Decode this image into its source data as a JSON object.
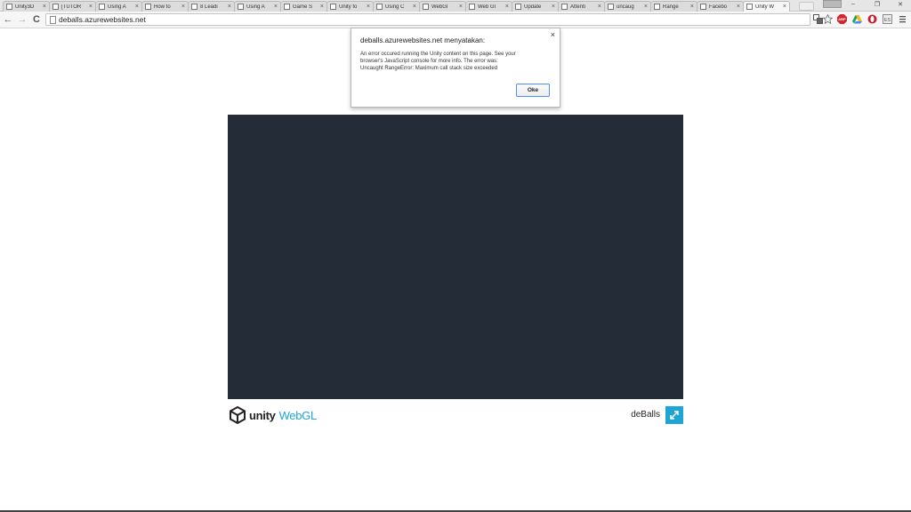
{
  "browser": {
    "tabs": [
      {
        "label": "Unity3D"
      },
      {
        "label": "[TUTOR"
      },
      {
        "label": "Using A"
      },
      {
        "label": "How to"
      },
      {
        "label": "8 Leadi"
      },
      {
        "label": "Using A"
      },
      {
        "label": "Game S"
      },
      {
        "label": "Unity fo"
      },
      {
        "label": "Using C"
      },
      {
        "label": "WebGl"
      },
      {
        "label": "Web Gl"
      },
      {
        "label": "Update"
      },
      {
        "label": "Attenti"
      },
      {
        "label": "uncaug"
      },
      {
        "label": "Range"
      },
      {
        "label": "Facebo"
      },
      {
        "label": "Unity W",
        "active": true
      }
    ],
    "tab_close_glyph": "×",
    "user_badge": "",
    "url": "deballs.azurewebsites.net",
    "window_controls": {
      "minimize": "–",
      "restore": "❐",
      "close": "✕"
    },
    "nav": {
      "back": "←",
      "forward": "→",
      "reload": "C"
    },
    "toolbar_icons": [
      "translate-icon",
      "bookmark-star-icon",
      "adblock-icon",
      "drive-icon",
      "opera-icon",
      "extension-icon",
      "menu-icon"
    ],
    "colors": {
      "adblock": "#d6262d",
      "drive": "#f2b81f"
    }
  },
  "page": {
    "canvas_color": "#232c37",
    "logo": {
      "unity": "unity",
      "webgl": "WebGL"
    },
    "game_title": "deBalls",
    "accent": "#1fa4d6"
  },
  "alert": {
    "title": "deballs.azurewebsites.net menyatakan:",
    "message_lines": [
      "An error occured running the Unity content on this page. See your",
      "browser's JavaScript console for more info. The error was:",
      "Uncaught RangeError: Maximum call stack size exceeded"
    ],
    "ok_label": "Oke",
    "close_glyph": "×"
  }
}
